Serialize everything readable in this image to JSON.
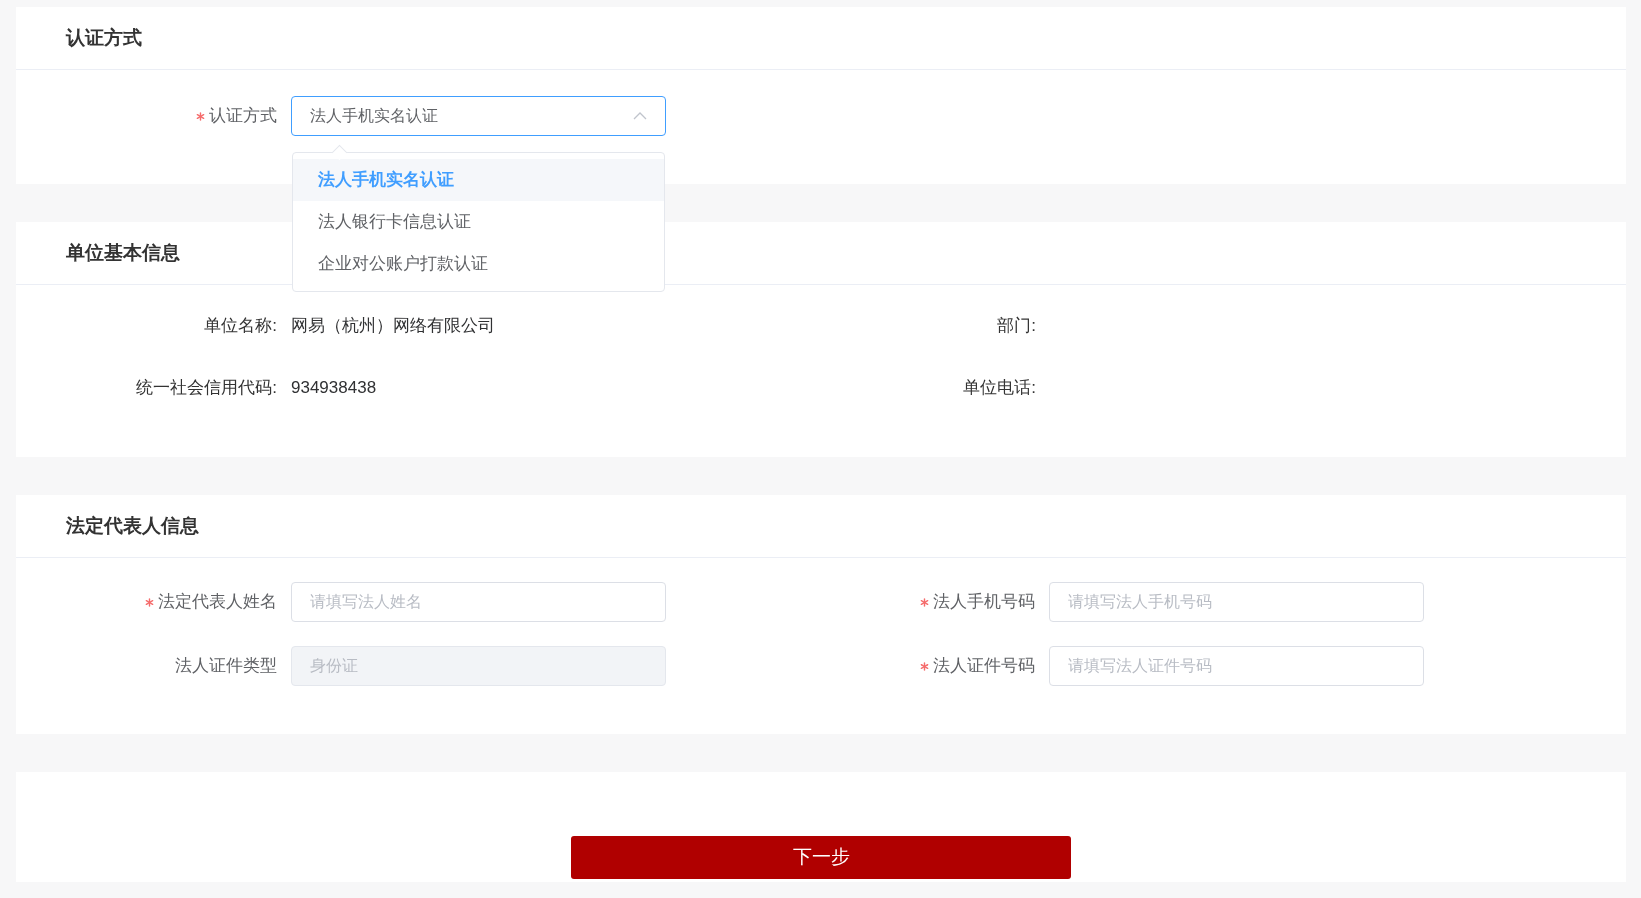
{
  "sections": [
    {
      "kind": "form",
      "title": "认证方式",
      "fields": [
        {
          "kind": "select",
          "label": "认证方式",
          "required": true,
          "value": "法人手机实名认证",
          "expanded": true,
          "options": [
            {
              "label": "法人手机实名认证",
              "selected": true
            },
            {
              "label": "法人银行卡信息认证",
              "selected": false
            },
            {
              "label": "企业对公账户打款认证",
              "selected": false
            }
          ]
        }
      ]
    },
    {
      "kind": "info",
      "title": "单位基本信息",
      "items": [
        {
          "label": "单位名称:",
          "value": "网易（杭州）网络有限公司"
        },
        {
          "label": "部门:"
        },
        {
          "label": "统一社会信用代码:",
          "value": "934938438"
        },
        {
          "label": "单位电话:"
        }
      ]
    },
    {
      "kind": "form",
      "title": "法定代表人信息",
      "fields": [
        {
          "kind": "input",
          "label": "法定代表人姓名",
          "required": true,
          "placeholder": "请填写法人姓名",
          "disabled": false
        },
        {
          "kind": "input",
          "label": "法人手机号码",
          "required": true,
          "placeholder": "请填写法人手机号码",
          "disabled": false
        },
        {
          "kind": "input",
          "label": "法人证件类型",
          "required": false,
          "placeholder": "身份证",
          "disabled": true
        },
        {
          "kind": "input",
          "label": "法人证件号码",
          "required": true,
          "placeholder": "请填写法人证件号码",
          "disabled": false
        }
      ]
    },
    {
      "kind": "actions",
      "buttons": [
        {
          "label": "下一步"
        }
      ]
    }
  ]
}
